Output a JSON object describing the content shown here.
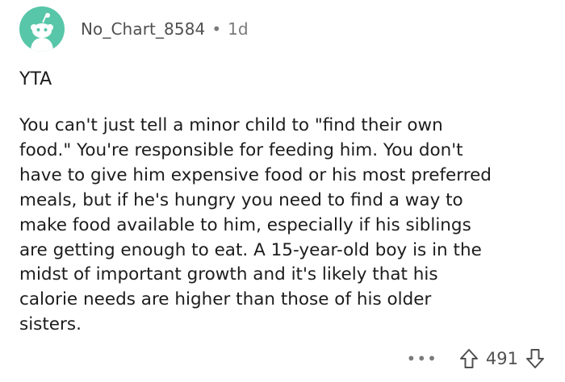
{
  "comment": {
    "username": "No_Chart_8584",
    "separator": "•",
    "age": "1d",
    "verdict": "YTA",
    "body_lines": [
      "You can't just tell a minor child to \"find their own",
      "food.\" You're responsible for feeding him. You don't",
      "have to give him expensive food or his most preferred",
      "meals, but if he's hungry you need to find a way to",
      "make food available to him, especially if his siblings",
      "are getting enough to eat. A 15-year-old boy is in the",
      "midst of important growth and it's likely that his",
      "calorie needs are higher than those of his older",
      "sisters."
    ],
    "more_label": "•••",
    "score": "491"
  },
  "icons": {
    "avatar": "snoo-avatar-icon",
    "upvote": "upvote-arrow-icon",
    "downvote": "downvote-arrow-icon",
    "more": "more-options-icon"
  },
  "colors": {
    "avatar_bg": "#58c6a8",
    "text": "#1c1c1c",
    "meta": "#7a7a7a"
  }
}
